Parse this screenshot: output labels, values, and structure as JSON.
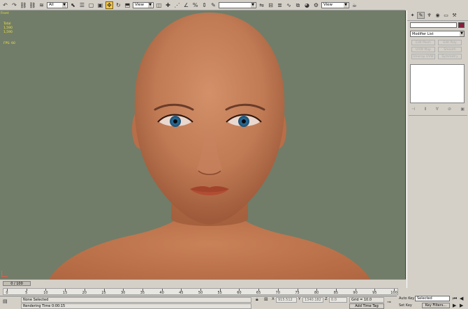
{
  "toolbar": {
    "selection_filter": "All",
    "reference_coord": "View",
    "named_selection": "",
    "view2": "View"
  },
  "viewport": {
    "label": "Front",
    "stats": [
      "Total",
      "1,590",
      "1,590"
    ],
    "fps": "FPS: 60",
    "background": "#717d68"
  },
  "command_panel": {
    "name_value": "",
    "object_color": "#8a1e3c",
    "modifier_list": "Modifier List",
    "modifier_buttons": [
      "Edit Mesh",
      "Edit Poly",
      "UVW Map",
      "Smooth",
      "Unwrap UVW",
      "Symmetry"
    ]
  },
  "timeline": {
    "frame_slider": "0 / 100",
    "ticks": [
      "0",
      "5",
      "10",
      "15",
      "20",
      "25",
      "30",
      "35",
      "40",
      "45",
      "50",
      "55",
      "60",
      "65",
      "70",
      "75",
      "80",
      "85",
      "90",
      "95",
      "100"
    ]
  },
  "status": {
    "selection": "None Selected",
    "prompt": "Rendering Time  0:00:15",
    "x_label": "X",
    "x_value": "915.512",
    "y_label": "Y",
    "y_value": "1340.182",
    "z_label": "Z",
    "z_value": "0.0",
    "grid": "Grid = 10.0",
    "add_time_tag": "Add Time Tag"
  },
  "animation": {
    "auto_key": "Auto Key",
    "selected": "Selected",
    "set_key": "Set Key",
    "key_filters": "Key Filters..."
  }
}
